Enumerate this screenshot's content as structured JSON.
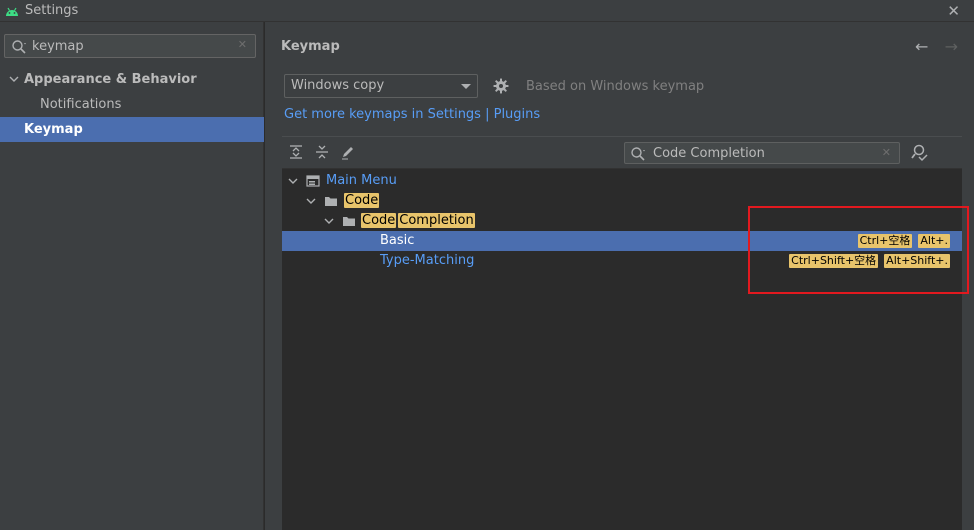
{
  "window": {
    "title": "Settings",
    "close_icon": "close-icon"
  },
  "search": {
    "value": "keymap",
    "clear_icon": "clear-icon"
  },
  "sidebar": {
    "items": [
      {
        "label": "Appearance & Behavior"
      },
      {
        "label": "Notifications"
      },
      {
        "label": "Keymap"
      }
    ]
  },
  "main": {
    "title": "Keymap",
    "keymap_select": "Windows copy",
    "based_on": "Based on Windows keymap",
    "more_link": "Get more keymaps in Settings | Plugins",
    "filter_value": "Code Completion"
  },
  "tree": {
    "main_menu": "Main Menu",
    "code": "Code",
    "code_completion_part1": "Code",
    "code_completion_part2": "Completion",
    "basic": {
      "label": "Basic",
      "shortcuts": [
        "Ctrl+空格",
        "Alt+."
      ]
    },
    "type_matching": {
      "label": "Type-Matching",
      "shortcuts": [
        "Ctrl+Shift+空格",
        "Alt+Shift+."
      ]
    }
  },
  "colors": {
    "accent": "#4b6eaf",
    "link": "#589df6",
    "highlight": "#e8c46b",
    "annotation": "#e2191f"
  }
}
